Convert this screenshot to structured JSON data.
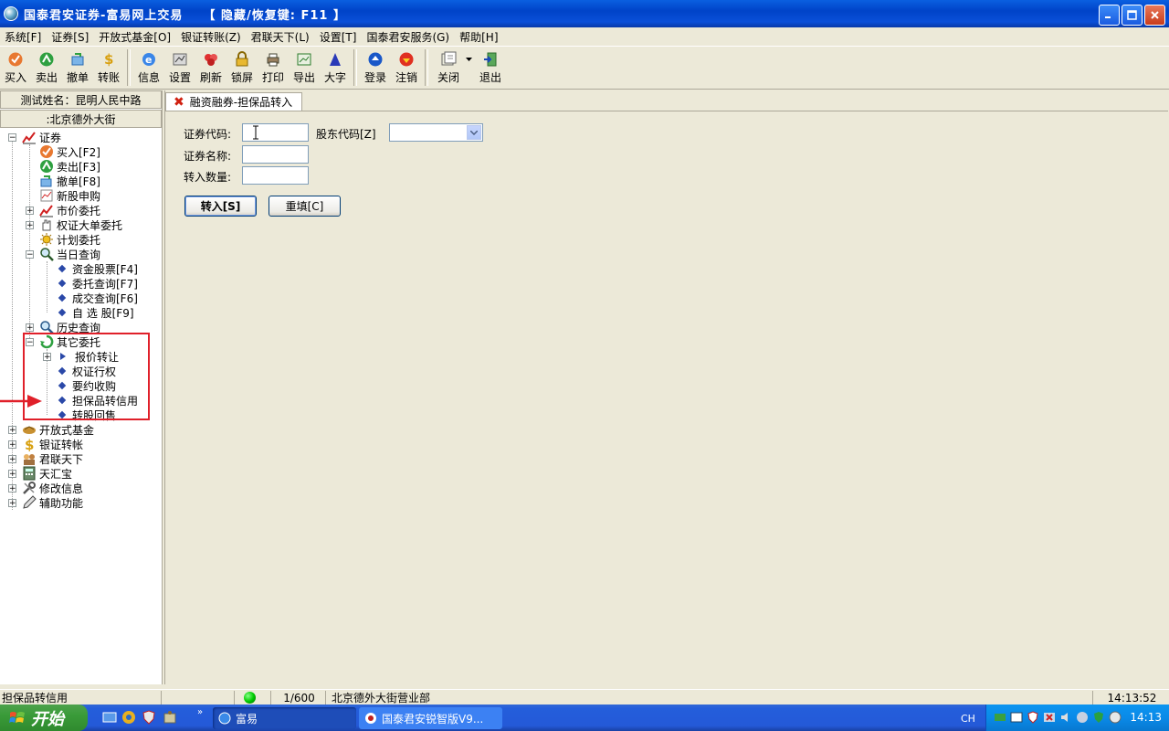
{
  "window": {
    "title": "国泰君安证券-富易网上交易    【 隐藏/恢复键: F11 】"
  },
  "menu": [
    "系统[F]",
    "证券[S]",
    "开放式基金[O]",
    "银证转账(Z)",
    "君联天下(L)",
    "设置[T]",
    "国泰君安服务(G)",
    "帮助[H]"
  ],
  "toolbar": [
    {
      "label": "买入",
      "icon": "buy-icon"
    },
    {
      "label": "卖出",
      "icon": "sell-icon"
    },
    {
      "label": "撤单",
      "icon": "cancel-order-icon"
    },
    {
      "label": "转账",
      "icon": "transfer-icon"
    },
    {
      "label": "信息",
      "icon": "info-icon"
    },
    {
      "label": "设置",
      "icon": "settings-icon"
    },
    {
      "label": "刷新",
      "icon": "refresh-icon"
    },
    {
      "label": "锁屏",
      "icon": "lock-icon"
    },
    {
      "label": "打印",
      "icon": "print-icon"
    },
    {
      "label": "导出",
      "icon": "export-icon"
    },
    {
      "label": "大字",
      "icon": "big-font-icon"
    },
    {
      "label": "登录",
      "icon": "login-icon"
    },
    {
      "label": "注销",
      "icon": "logout-icon"
    },
    {
      "label": "关闭",
      "icon": "close-window-icon"
    },
    {
      "label": "退出",
      "icon": "exit-icon"
    }
  ],
  "left": {
    "info1": "测试姓名：昆明人民中路",
    "info2": ":北京德外大街"
  },
  "tree": {
    "securities": "证券",
    "buy": "买入[F2]",
    "sell": "卖出[F3]",
    "cancel": "撤单[F8]",
    "ipo": "新股申购",
    "market_order": "市价委托",
    "warrant_big": "权证大单委托",
    "plan_order": "计划委托",
    "today_query": "当日查询",
    "funds_stocks": "资金股票[F4]",
    "order_query": "委托查询[F7]",
    "deal_query": "成交查询[F6]",
    "watchlist": "自 选 股[F9]",
    "history_query": "历史查询",
    "other_orders": "其它委托",
    "quote_transfer": "报价转让",
    "warrant_exercise": "权证行权",
    "tender_offer": "要约收购",
    "collateral_transfer": "担保品转信用",
    "convert_putback": "转股回售",
    "open_fund": "开放式基金",
    "bank_transfer": "银证转帐",
    "junlian": "君联天下",
    "tianhuibao": "天汇宝",
    "modify_info": "修改信息",
    "aux": "辅助功能"
  },
  "tab": {
    "label": "融资融券-担保品转入"
  },
  "form": {
    "code_label": "证券代码:",
    "code_value": "",
    "holder_label": "股东代码[Z]",
    "holder_value": "",
    "name_label": "证券名称:",
    "name_value": "",
    "qty_label": "转入数量:",
    "qty_value": "",
    "submit_label": "转入[S]",
    "reset_label": "重填[C]"
  },
  "status": {
    "text": "担保品转信用",
    "count": "1/600",
    "branch": "北京德外大街营业部",
    "time": "14:13:52"
  },
  "taskbar": {
    "start": "开始",
    "task1": "富易",
    "task2": "国泰君安锐智版V9...",
    "ime": "CH",
    "clock": "14:13"
  },
  "colors": {
    "titlebar": "#0A5FE0",
    "highlight": "#E0202A",
    "panel": "#ECE9D8"
  }
}
